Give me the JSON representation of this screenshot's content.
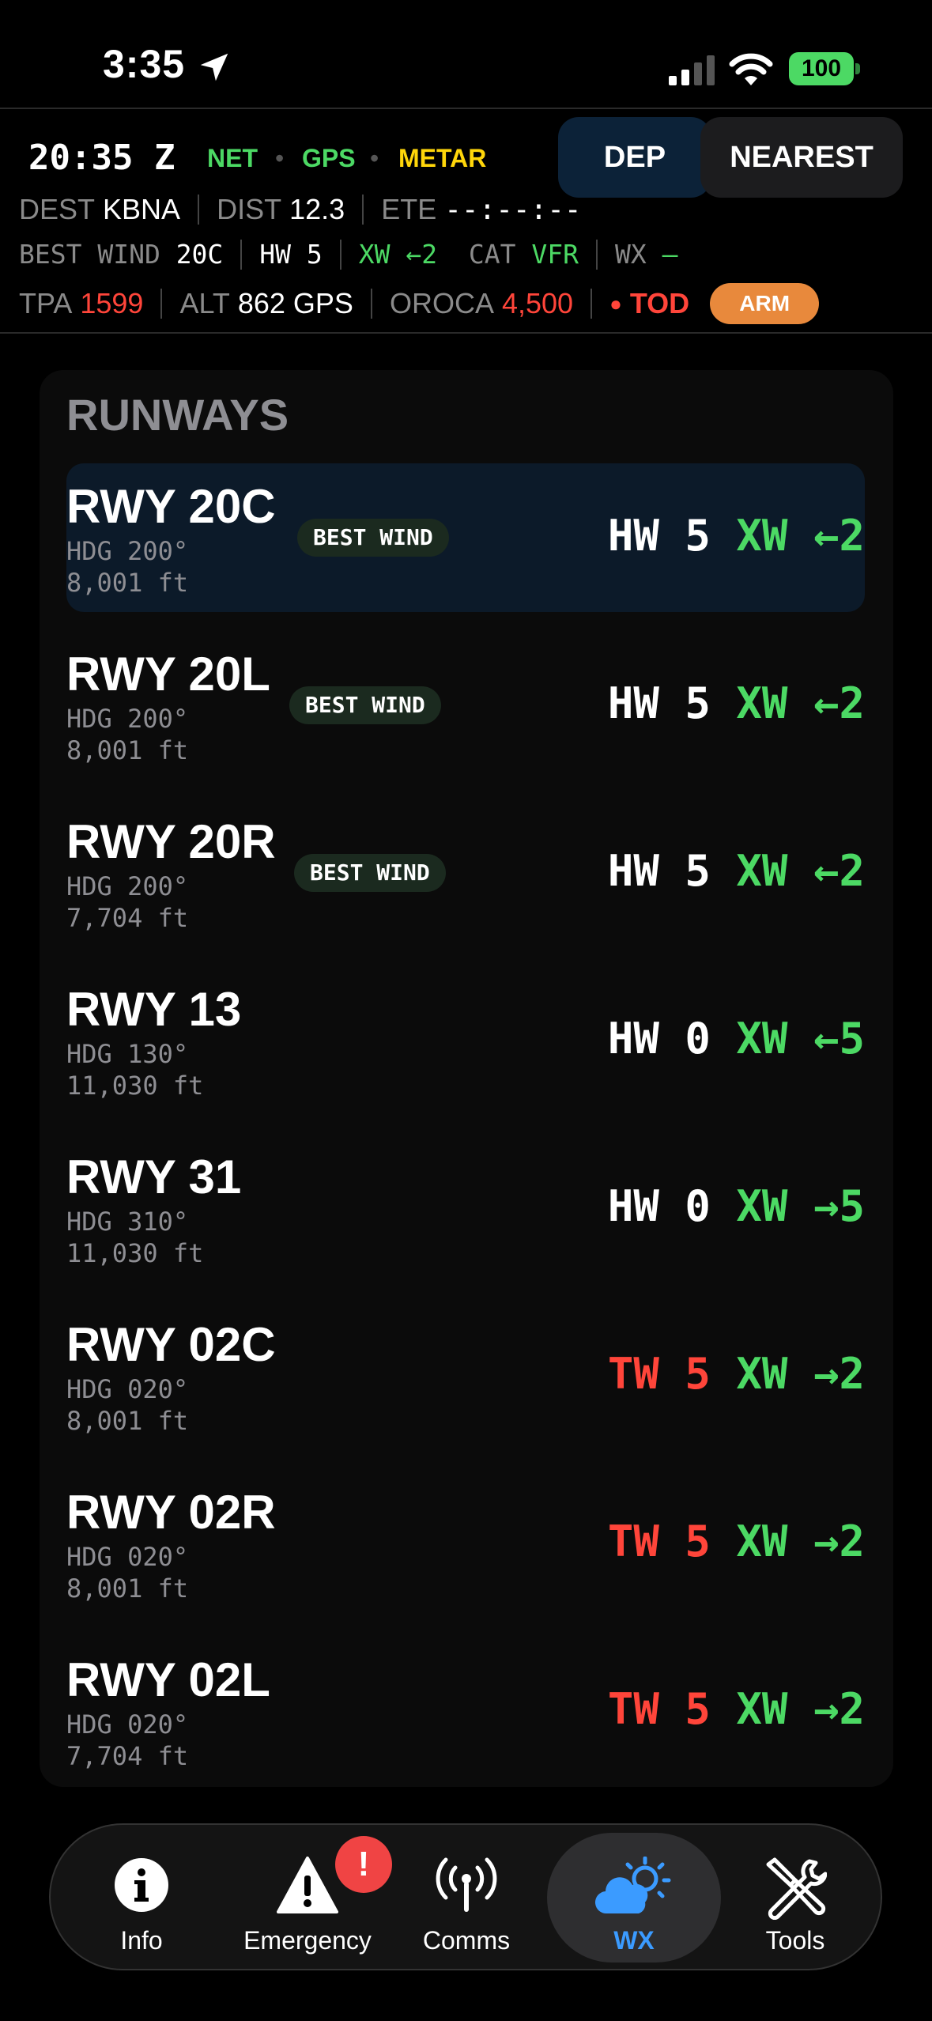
{
  "status_bar": {
    "time": "3:35",
    "battery": "100"
  },
  "header": {
    "zulu": "20:35 Z",
    "sources": [
      "NET",
      "GPS",
      "METAR"
    ],
    "dep_label": "DEP",
    "nearest_label": "NEAREST",
    "dest_label": "DEST",
    "dest_value": "KBNA",
    "dist_label": "DIST",
    "dist_value": "12.3",
    "ete_label": "ETE",
    "ete_value": "--:--:--",
    "best_wind_label": "BEST WIND",
    "best_wind_value": "20C",
    "hw_value": "HW 5",
    "xw_value": "XW ←2",
    "cat_label": "CAT",
    "cat_value": "VFR",
    "wx_label": "WX",
    "wx_value": "—",
    "tpa_label": "TPA",
    "tpa_value": "1599",
    "alt_label": "ALT",
    "alt_value": "862",
    "alt_src": "GPS",
    "oroca_label": "OROCA",
    "oroca_value": "4,500",
    "tod_label": "TOD",
    "arm_label": "ARM"
  },
  "runways": {
    "title": "RUNWAYS",
    "items": [
      {
        "name": "RWY 20C",
        "hdg": "HDG 200°",
        "length": "8,001 ft",
        "badge": "BEST WIND",
        "wind_type": "HW",
        "wind_val": "5",
        "xw_label": "XW",
        "xw_val": "←2",
        "selected": true
      },
      {
        "name": "RWY 20L",
        "hdg": "HDG 200°",
        "length": "8,001 ft",
        "badge": "BEST WIND",
        "wind_type": "HW",
        "wind_val": "5",
        "xw_label": "XW",
        "xw_val": "←2",
        "selected": false
      },
      {
        "name": "RWY 20R",
        "hdg": "HDG 200°",
        "length": "7,704 ft",
        "badge": "BEST WIND",
        "wind_type": "HW",
        "wind_val": "5",
        "xw_label": "XW",
        "xw_val": "←2",
        "selected": false
      },
      {
        "name": "RWY 13",
        "hdg": "HDG 130°",
        "length": "11,030 ft",
        "badge": "",
        "wind_type": "HW",
        "wind_val": "0",
        "xw_label": "XW",
        "xw_val": "←5",
        "selected": false
      },
      {
        "name": "RWY 31",
        "hdg": "HDG 310°",
        "length": "11,030 ft",
        "badge": "",
        "wind_type": "HW",
        "wind_val": "0",
        "xw_label": "XW",
        "xw_val": "→5",
        "selected": false
      },
      {
        "name": "RWY 02C",
        "hdg": "HDG 020°",
        "length": "8,001 ft",
        "badge": "",
        "wind_type": "TW",
        "wind_val": "5",
        "xw_label": "XW",
        "xw_val": "→2",
        "selected": false
      },
      {
        "name": "RWY 02R",
        "hdg": "HDG 020°",
        "length": "8,001 ft",
        "badge": "",
        "wind_type": "TW",
        "wind_val": "5",
        "xw_label": "XW",
        "xw_val": "→2",
        "selected": false
      },
      {
        "name": "RWY 02L",
        "hdg": "HDG 020°",
        "length": "7,704 ft",
        "badge": "",
        "wind_type": "TW",
        "wind_val": "5",
        "xw_label": "XW",
        "xw_val": "→2",
        "selected": false
      }
    ]
  },
  "tabbar": {
    "info": "Info",
    "emergency": "Emergency",
    "emergency_badge": "!",
    "comms": "Comms",
    "wx": "WX",
    "tools": "Tools"
  },
  "colors": {
    "green": "#4cd964",
    "red": "#ff453a",
    "yellow": "#ffd60a",
    "blue": "#3b9bff",
    "orange": "#e8893c"
  }
}
